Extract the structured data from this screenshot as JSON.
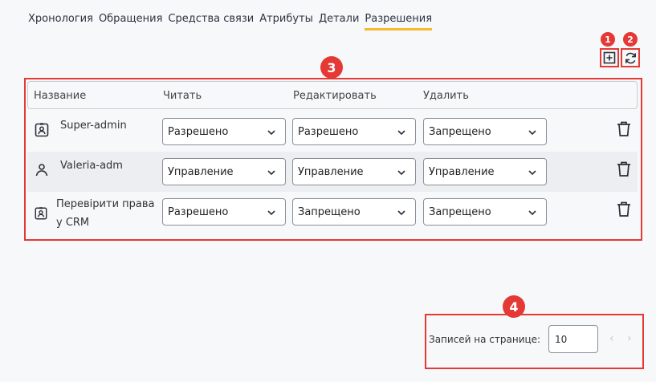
{
  "tabs": [
    {
      "label": "Хронология"
    },
    {
      "label": "Обращения"
    },
    {
      "label": "Средства связи"
    },
    {
      "label": "Атрибуты"
    },
    {
      "label": "Детали"
    },
    {
      "label": "Разрешения",
      "active": true
    }
  ],
  "toolbar": {
    "add_icon": "plus-square-icon",
    "refresh_icon": "refresh-icon"
  },
  "annotations": {
    "one": "1",
    "two": "2",
    "three": "3",
    "four": "4",
    "color": "#e53935"
  },
  "table": {
    "headers": {
      "name": "Название",
      "read": "Читать",
      "edit": "Редактировать",
      "delete": "Удалить"
    },
    "rows": [
      {
        "icon": "badge-icon",
        "name": "Super-admin",
        "read": "Разрешено",
        "edit": "Разрешено",
        "delete": "Запрещено"
      },
      {
        "icon": "user-icon",
        "name": "Valeria-adm",
        "read": "Управление",
        "edit": "Управление",
        "delete": "Управление"
      },
      {
        "icon": "badge-icon",
        "name_line1": "Перевірити права",
        "name_line2": "у CRM",
        "read": "Разрешено",
        "edit": "Запрещено",
        "delete": "Запрещено"
      }
    ]
  },
  "pagination": {
    "label": "Записей на странице:",
    "page_size": "10",
    "prev": "‹",
    "next": "›"
  },
  "colors": {
    "accent_tab": "#f5b82e",
    "row_alt": "#eceef1"
  }
}
